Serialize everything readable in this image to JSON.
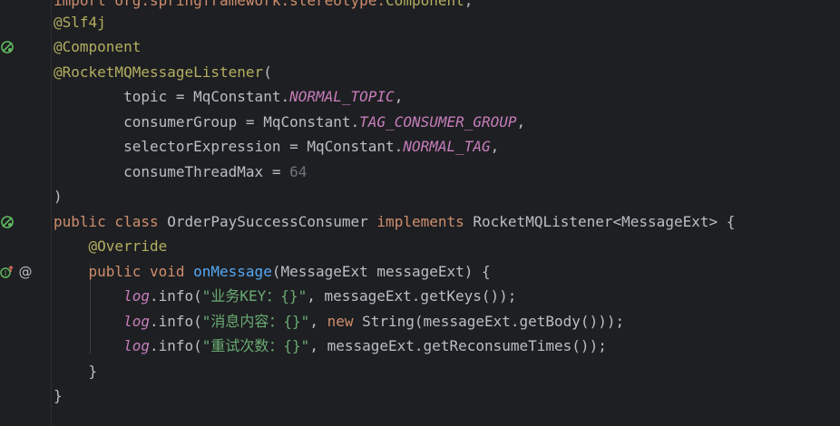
{
  "editor": {
    "lines": [
      {
        "tokens": [
          {
            "t": "import org.springframework.stereotype.",
            "c": "kw-dim"
          },
          {
            "t": "Component",
            "c": "anno"
          },
          {
            "t": ";",
            "c": "plain"
          }
        ]
      },
      {
        "tokens": [
          {
            "t": "@Slf4j",
            "c": "anno"
          }
        ]
      },
      {
        "tokens": [
          {
            "t": "@Component",
            "c": "anno"
          }
        ]
      },
      {
        "tokens": [
          {
            "t": "@RocketMQMessageListener",
            "c": "anno"
          },
          {
            "t": "(",
            "c": "plain"
          }
        ]
      },
      {
        "tokens": [
          {
            "t": "        topic = MqConstant.",
            "c": "plain"
          },
          {
            "t": "NORMAL_TOPIC",
            "c": "const"
          },
          {
            "t": ",",
            "c": "plain"
          }
        ]
      },
      {
        "tokens": [
          {
            "t": "        consumerGroup = MqConstant.",
            "c": "plain"
          },
          {
            "t": "TAG_CONSUMER_GROUP",
            "c": "const"
          },
          {
            "t": ",",
            "c": "plain"
          }
        ]
      },
      {
        "tokens": [
          {
            "t": "        selectorExpression = MqConstant.",
            "c": "plain"
          },
          {
            "t": "NORMAL_TAG",
            "c": "const"
          },
          {
            "t": ",",
            "c": "plain"
          }
        ]
      },
      {
        "tokens": [
          {
            "t": "        consumeThreadMax = ",
            "c": "plain"
          },
          {
            "t": "64",
            "c": "dim"
          }
        ]
      },
      {
        "tokens": [
          {
            "t": ")",
            "c": "plain"
          }
        ]
      },
      {
        "tokens": [
          {
            "t": "public class ",
            "c": "kw"
          },
          {
            "t": "OrderPaySuccessConsumer ",
            "c": "plain"
          },
          {
            "t": "implements ",
            "c": "kw"
          },
          {
            "t": "RocketMQListener<MessageExt> {",
            "c": "plain"
          }
        ]
      },
      {
        "tokens": [
          {
            "t": "    ",
            "c": "plain"
          },
          {
            "t": "@Override",
            "c": "anno"
          }
        ]
      },
      {
        "tokens": [
          {
            "t": "    ",
            "c": "plain"
          },
          {
            "t": "public void ",
            "c": "kw"
          },
          {
            "t": "onMessage",
            "c": "fn"
          },
          {
            "t": "(MessageExt messageExt) {",
            "c": "plain"
          }
        ]
      },
      {
        "tokens": [
          {
            "t": "        ",
            "c": "plain"
          },
          {
            "t": "log",
            "c": "static-call"
          },
          {
            "t": ".info(",
            "c": "plain"
          },
          {
            "t": "\"业务KEY：{}\"",
            "c": "str"
          },
          {
            "t": ", messageExt.getKeys());",
            "c": "plain"
          }
        ]
      },
      {
        "tokens": [
          {
            "t": "        ",
            "c": "plain"
          },
          {
            "t": "log",
            "c": "static-call"
          },
          {
            "t": ".info(",
            "c": "plain"
          },
          {
            "t": "\"消息内容：{}\"",
            "c": "str"
          },
          {
            "t": ", ",
            "c": "plain"
          },
          {
            "t": "new ",
            "c": "kw"
          },
          {
            "t": "String(messageExt.getBody()));",
            "c": "plain"
          }
        ]
      },
      {
        "tokens": [
          {
            "t": "        ",
            "c": "plain"
          },
          {
            "t": "log",
            "c": "static-call"
          },
          {
            "t": ".info(",
            "c": "plain"
          },
          {
            "t": "\"重试次数：{}\"",
            "c": "str"
          },
          {
            "t": ", messageExt.getReconsumeTimes());",
            "c": "plain"
          }
        ]
      },
      {
        "tokens": [
          {
            "t": "    }",
            "c": "plain"
          }
        ]
      },
      {
        "tokens": [
          {
            "t": "}",
            "c": "plain"
          }
        ]
      }
    ],
    "gutter_icons": [
      {
        "name": "bean-icon",
        "line": 2
      },
      {
        "name": "bean-icon",
        "line": 9
      },
      {
        "name": "implements-method-icon",
        "line": 11
      },
      {
        "name": "annotation-at-icon",
        "line": 11
      }
    ]
  },
  "colors": {
    "background": "#1e1f22",
    "annotation": "#b3ae60",
    "keyword": "#cf8e6d",
    "function": "#56a8f5",
    "string": "#6aab73",
    "constant": "#c77dbb",
    "text": "#bcbec4",
    "gutter_icon": "#5fb85f"
  }
}
